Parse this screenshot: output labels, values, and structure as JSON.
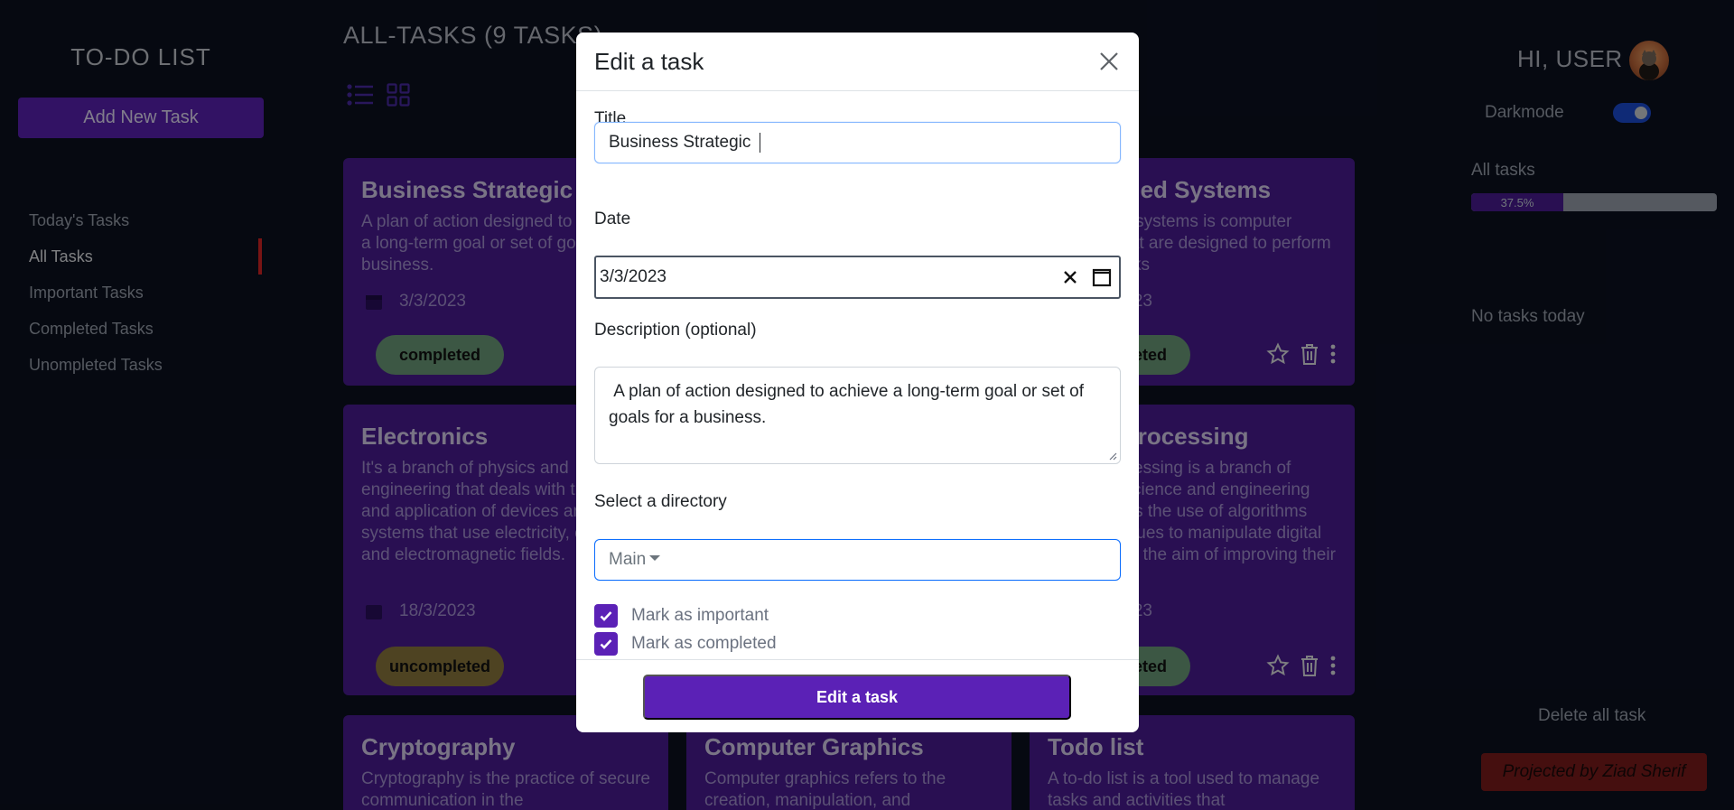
{
  "sidebar": {
    "app_title": "TO-DO LIST",
    "add_button": "Add New Task",
    "nav": [
      {
        "label": "Today's Tasks",
        "active": false
      },
      {
        "label": "All Tasks",
        "active": true
      },
      {
        "label": "Important Tasks",
        "active": false
      },
      {
        "label": "Completed Tasks",
        "active": false
      },
      {
        "label": "Unompleted Tasks",
        "active": false
      }
    ]
  },
  "main": {
    "title": "ALL-TASKS (9 TASKS)",
    "cards": [
      {
        "title": "Business Strategic",
        "desc": "A plan of action designed to achieve a long-term goal or set of goals for a business.",
        "date": "3/3/2023",
        "status": "completed"
      },
      {
        "title": "Embedded Systems",
        "desc": "Embedded systems is computer systems that are designed to perform specific tasks",
        "date": "3/3/2023",
        "status": "completed"
      },
      {
        "title": "Electronics",
        "desc": "It's a branch of physics and engineering that deals with the study and application of devices and systems that use electricity, electrons, and electromagnetic fields.",
        "date": "18/3/2023",
        "status": "uncompleted"
      },
      {
        "title": "Image Processing",
        "desc": "Image processing is a branch of computer science and engineering that involves the use of algorithms and techniques to manipulate digital images with the aim of improving their quality.",
        "date": "3/3/2023",
        "status": "completed"
      },
      {
        "title": "Cryptography",
        "desc": "Cryptography is the practice of secure communication in the"
      },
      {
        "title": "Computer Graphics",
        "desc": "Computer graphics refers to the creation, manipulation, and"
      },
      {
        "title": "Todo list",
        "desc": "A to-do list is a tool used to manage tasks and activities that"
      }
    ]
  },
  "right_panel": {
    "greeting": "HI, USER",
    "darkmode_label": "Darkmode",
    "all_tasks_label": "All tasks",
    "progress_label": "37.5%",
    "progress_fraction": 0.375,
    "no_tasks_today": "No tasks today",
    "delete_all": "Delete all task",
    "projected_by": "Projected by Ziad Sherif"
  },
  "modal": {
    "title": "Edit a task",
    "title_label": "Title",
    "title_value": "Business Strategic ",
    "date_label": "Date",
    "date_value": "3/3/2023",
    "description_label": "Description (optional)",
    "description_value": " A plan of action designed to achieve a long-term goal or set of goals for a business.",
    "directory_label": "Select a directory",
    "directory_value": "Main",
    "important_label": "Mark as important",
    "completed_label": "Mark as completed",
    "submit_label": "Edit a task"
  },
  "colors": {
    "background": "#0b1120",
    "card": "#4c1d95",
    "accent": "#5b21b6",
    "completed": "#6e9e7d",
    "uncompleted": "#8e7b3e",
    "active_indicator": "#dc2626"
  }
}
